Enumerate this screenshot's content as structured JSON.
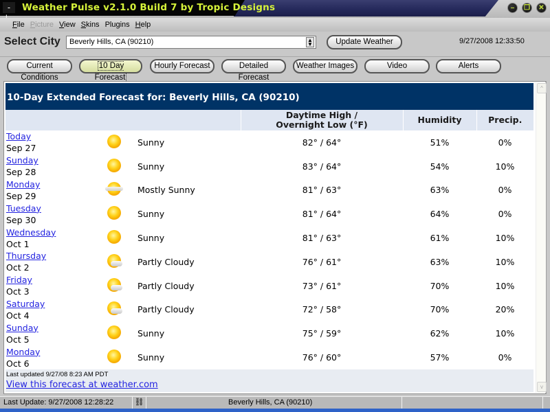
{
  "window": {
    "title": "Weather Pulse v2.1.0 Build 7 by Tropic Designs",
    "app_icon_glyph": "-|-",
    "controls": [
      {
        "name": "minimize",
        "glyph": "–"
      },
      {
        "name": "restore",
        "glyph": "❐"
      },
      {
        "name": "close",
        "glyph": "✕"
      }
    ]
  },
  "menu": [
    {
      "label": "File",
      "accel": "F",
      "rest": "ile",
      "enabled": true
    },
    {
      "label": "Picture",
      "accel": "P",
      "rest": "icture",
      "enabled": false
    },
    {
      "label": "View",
      "accel": "V",
      "rest": "iew",
      "enabled": true
    },
    {
      "label": "Skins",
      "accel": "S",
      "rest": "kins",
      "enabled": true
    },
    {
      "label": "Plugins",
      "accel": "",
      "rest": "Plugins",
      "enabled": true
    },
    {
      "label": "Help",
      "accel": "H",
      "rest": "elp",
      "enabled": true
    }
  ],
  "city_bar": {
    "label": "Select City",
    "selected_city": "Beverly Hills, CA (90210)",
    "update_button": "Update Weather",
    "clock": "9/27/2008 12:33:50"
  },
  "tabs": [
    {
      "label": "Current Conditions",
      "active": false
    },
    {
      "label": "10 Day Forecast",
      "active": true
    },
    {
      "label": "Hourly Forecast",
      "active": false
    },
    {
      "label": "Detailed Forecast",
      "active": false
    },
    {
      "label": "Weather Images",
      "active": false
    },
    {
      "label": "Video",
      "active": false
    },
    {
      "label": "Alerts",
      "active": false
    }
  ],
  "forecast": {
    "heading": "10-Day Extended Forecast for: Beverly Hills, CA (90210)",
    "columns": {
      "temp_line1": "Daytime High /",
      "temp_line2": "Overnight Low (°F)",
      "humidity": "Humidity",
      "precip": "Precip."
    },
    "days": [
      {
        "day": "Today",
        "date": "Sep 27",
        "icon": "sunny-icon",
        "condition": "Sunny",
        "temps": "82° / 64°",
        "humidity": "51%",
        "precip": "0%"
      },
      {
        "day": "Sunday",
        "date": "Sep 28",
        "icon": "sunny-icon",
        "condition": "Sunny",
        "temps": "83° / 64°",
        "humidity": "54%",
        "precip": "10%"
      },
      {
        "day": "Monday",
        "date": "Sep 29",
        "icon": "mostly-sunny-icon",
        "condition": "Mostly Sunny",
        "temps": "81° / 63°",
        "humidity": "63%",
        "precip": "0%"
      },
      {
        "day": "Tuesday",
        "date": "Sep 30",
        "icon": "sunny-icon",
        "condition": "Sunny",
        "temps": "81° / 64°",
        "humidity": "64%",
        "precip": "0%"
      },
      {
        "day": "Wednesday",
        "date": "Oct 1",
        "icon": "sunny-icon",
        "condition": "Sunny",
        "temps": "81° / 63°",
        "humidity": "61%",
        "precip": "10%"
      },
      {
        "day": "Thursday",
        "date": "Oct 2",
        "icon": "partly-cloudy-icon",
        "condition": "Partly Cloudy",
        "temps": "76° / 61°",
        "humidity": "63%",
        "precip": "10%"
      },
      {
        "day": "Friday",
        "date": "Oct 3",
        "icon": "partly-cloudy-icon",
        "condition": "Partly Cloudy",
        "temps": "73° / 61°",
        "humidity": "70%",
        "precip": "10%"
      },
      {
        "day": "Saturday",
        "date": "Oct 4",
        "icon": "partly-cloudy-icon",
        "condition": "Partly Cloudy",
        "temps": "72° / 58°",
        "humidity": "70%",
        "precip": "20%"
      },
      {
        "day": "Sunday",
        "date": "Oct 5",
        "icon": "sunny-icon",
        "condition": "Sunny",
        "temps": "75° / 59°",
        "humidity": "62%",
        "precip": "10%"
      },
      {
        "day": "Monday",
        "date": "Oct 6",
        "icon": "sunny-icon",
        "condition": "Sunny",
        "temps": "76° / 60°",
        "humidity": "57%",
        "precip": "0%"
      }
    ],
    "last_updated": "Last updated 9/27/08 8:23 AM PDT",
    "weather_link": "View this forecast at weather.com"
  },
  "scrollbar": {
    "up_glyph": "^",
    "down_glyph": "v"
  },
  "statusbar": {
    "last_update": "Last Update: 9/27/2008 12:28:22",
    "connection_icon": "⛓",
    "city": "Beverly Hills, CA (90210)",
    "extra": ""
  }
}
